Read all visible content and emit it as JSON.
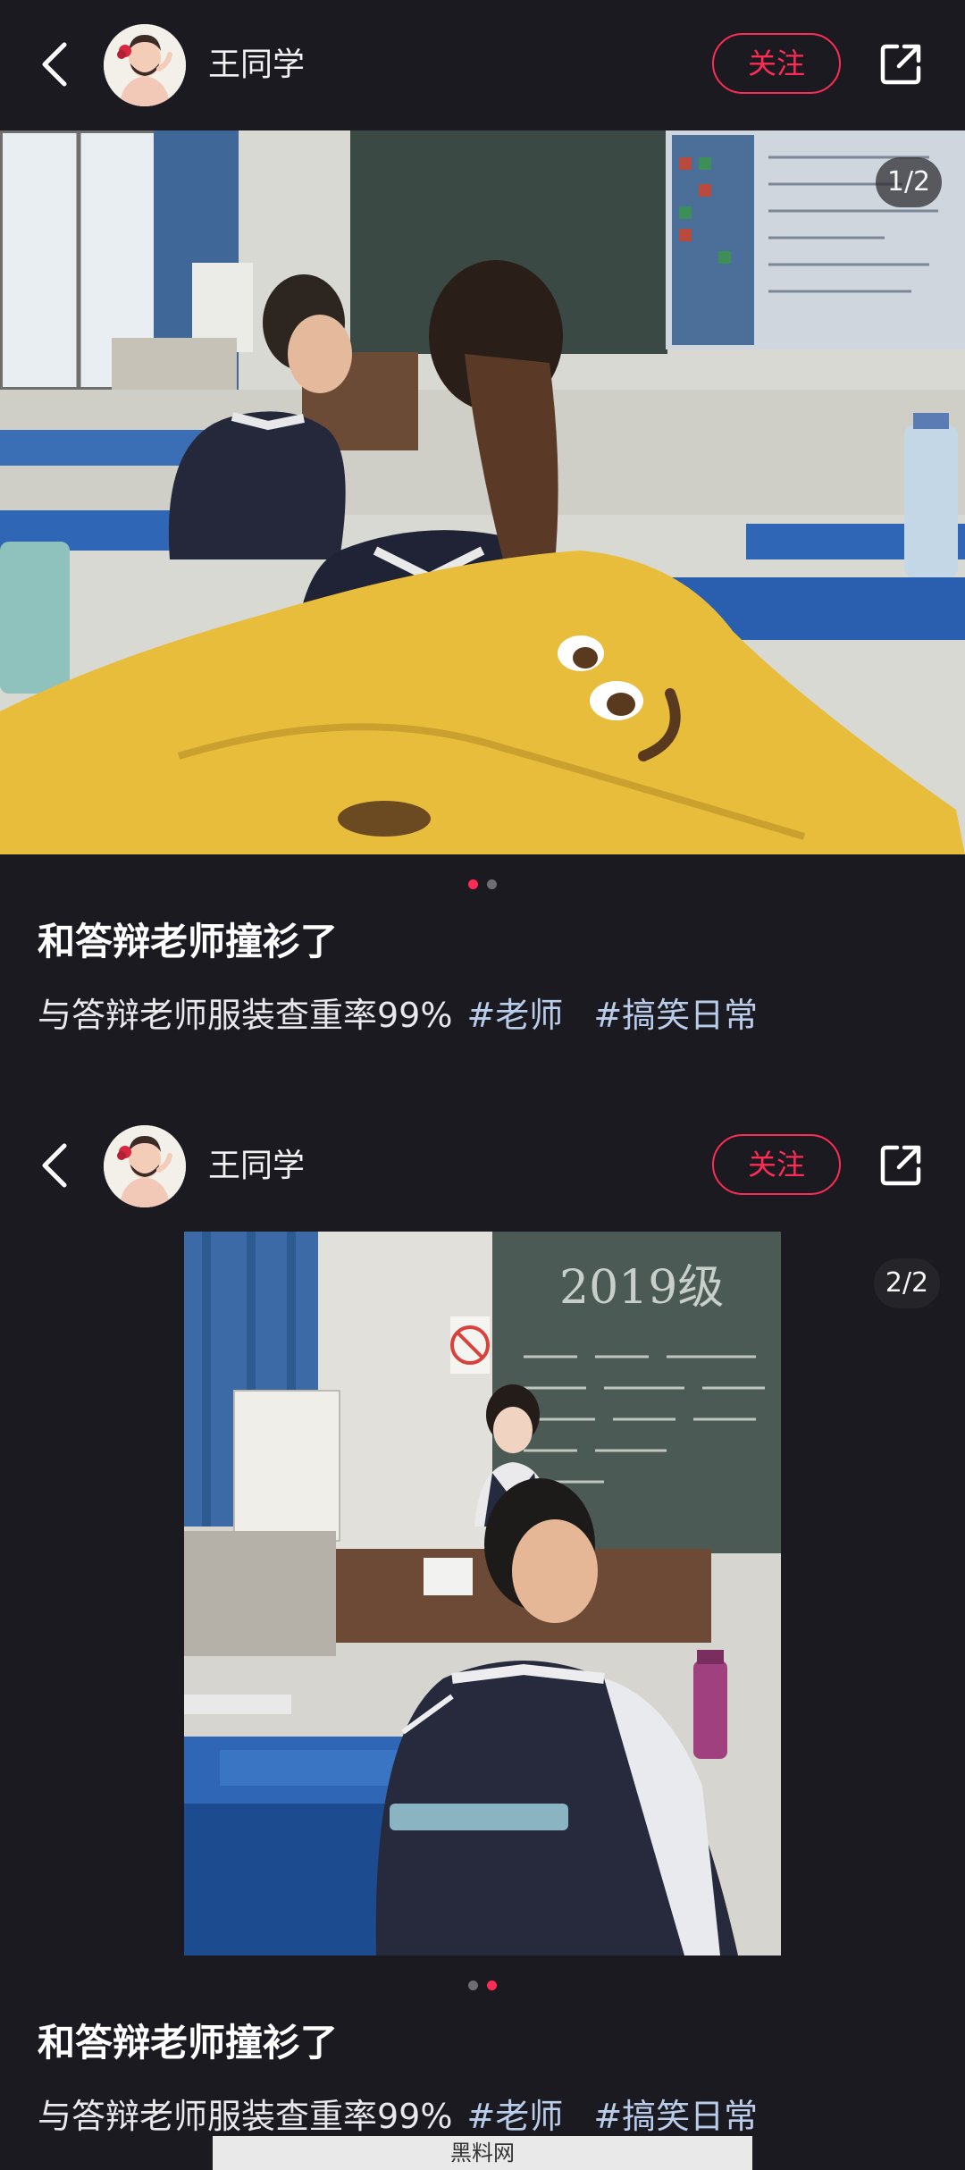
{
  "posts": [
    {
      "author": "王同学",
      "follow_label": "关注",
      "counter": "1/2",
      "title": "和答辩老师撞衫了",
      "description": "与答辩老师服装查重率99%",
      "tags": [
        "#老师",
        "#搞笑日常"
      ],
      "slide_index": 1,
      "slide_total": 2
    },
    {
      "author": "王同学",
      "follow_label": "关注",
      "counter": "2/2",
      "title": "和答辩老师撞衫了",
      "description": "与答辩老师服装查重率99%",
      "tags": [
        "#老师",
        "#搞笑日常"
      ],
      "slide_index": 2,
      "slide_total": 2
    }
  ],
  "photo2": {
    "board_text": "2019级"
  },
  "watermark": "黑料网",
  "colors": {
    "background": "#1b1a20",
    "accent": "#fe2c55",
    "tag": "#b9cdea"
  },
  "icons": [
    "back-arrow-icon",
    "share-icon",
    "avatar"
  ]
}
